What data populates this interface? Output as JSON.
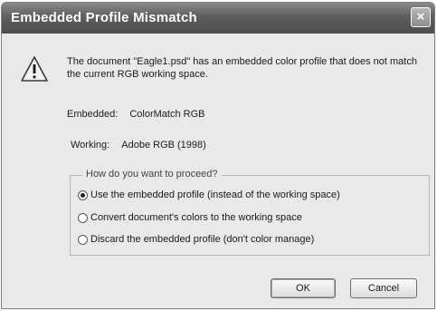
{
  "dialog": {
    "title": "Embedded Profile Mismatch",
    "close_label": "×",
    "message": "The document \"Eagle1.psd\" has an embedded color profile that does not match the current RGB working space.",
    "embedded": {
      "label": "Embedded:",
      "value": "ColorMatch RGB"
    },
    "working": {
      "label": "Working:",
      "value": "Adobe RGB (1998)"
    },
    "options_group": {
      "legend": "How do you want to proceed?",
      "options": [
        {
          "label": "Use the embedded profile (instead of the working space)",
          "checked": true
        },
        {
          "label": "Convert document's colors to the working space",
          "checked": false
        },
        {
          "label": "Discard the embedded profile (don't color manage)",
          "checked": false
        }
      ]
    },
    "buttons": {
      "ok": "OK",
      "cancel": "Cancel"
    },
    "icon": "warning-triangle-icon"
  }
}
